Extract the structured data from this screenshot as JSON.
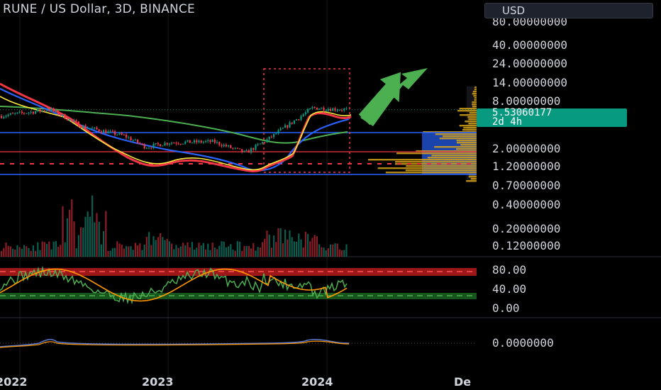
{
  "header": {
    "title": "RUNE / US Dollar, 3D, BINANCE",
    "currency_button": "USD"
  },
  "price_tag": {
    "price": "5.53060177",
    "countdown": "2d 4h"
  },
  "colors": {
    "background": "#000000",
    "up_candle": "#089981",
    "down_candle": "#f23645",
    "ma_blue": "#2962ff",
    "ma_green": "#4caf50",
    "ribbon_red": "#f23645",
    "ribbon_yellow": "#ffeb3b",
    "rsi_green": "#4caf50",
    "rsi_orange": "#ff9800",
    "arrow_green": "#4caf50",
    "volume_profile": "#d4a017"
  },
  "chart_data": {
    "type": "candlestick",
    "title": "RUNE / US Dollar, 3D, BINANCE",
    "y_scale": "log",
    "price_axis_ticks": [
      "80.00000000",
      "40.00000000",
      "24.00000000",
      "14.00000000",
      "8.00000000",
      "2.00000000",
      "1.20000000",
      "0.70000000",
      "0.40000000",
      "0.20000000",
      "0.12000000"
    ],
    "x_tick_labels": [
      "2022",
      "2023",
      "2024",
      "De"
    ],
    "last_price": 5.53060177,
    "price_path_approx": [
      {
        "x": "2022",
        "y": 4.3
      },
      {
        "x": "2022 Q1",
        "y": 5.6
      },
      {
        "x": "2022 Q2",
        "y": 2.8
      },
      {
        "x": "2022 Q3",
        "y": 1.9
      },
      {
        "x": "2022 Q4",
        "y": 1.2
      },
      {
        "x": "2023",
        "y": 1.45
      },
      {
        "x": "2023 Q2",
        "y": 1.5
      },
      {
        "x": "2023 Q3",
        "y": 0.95
      },
      {
        "x": "2023 Q4",
        "y": 1.6
      },
      {
        "x": "2024",
        "y": 6.0
      },
      {
        "x": "2024 Q1",
        "y": 5.53
      }
    ],
    "horizontal_levels": [
      3.15,
      1.85,
      1.05
    ],
    "dashed_level": 1.35,
    "rsi_panel": {
      "ticks": [
        "80.00",
        "40.00",
        "0.00"
      ],
      "upper_band": 75,
      "lower_band": 22
    },
    "macd_panel": {
      "ticks": [
        "0.0000000"
      ]
    }
  }
}
